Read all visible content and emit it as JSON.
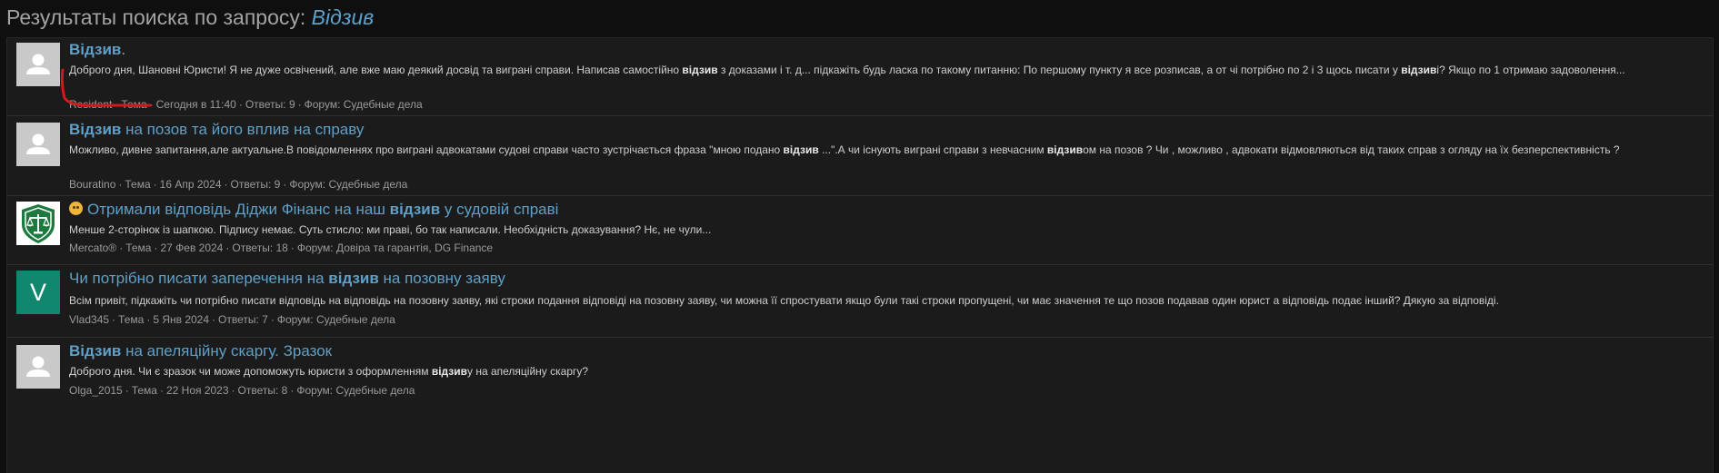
{
  "page": {
    "title_prefix": "Результаты поиска по запросу: ",
    "query": "Відзив"
  },
  "results": [
    {
      "title_parts": [
        "Відзив",
        "."
      ],
      "snippet": [
        "Доброго дня, Шановні Юристи! Я не дуже освічений, але вже маю деякий досвід та виграні справи. Написав самостійно ",
        "відзив",
        " з доказами і т. д... підкажіть будь ласка по такому питанню: По першому пункту я все розписав, а от чі потрібно по 2 і 3 щось писати у ",
        "відзив",
        "і? Якщо по 1 отримаю задоволення..."
      ],
      "meta": {
        "author": "Resident",
        "type": "Тема",
        "date": "Сегодня в 11:40",
        "replies": "Ответы: 9",
        "forum": "Форум: Судебные дела"
      },
      "avatar": "default-user"
    },
    {
      "title_parts": [
        "Відзив",
        " на позов та його вплив на справу"
      ],
      "snippet": [
        "Можливо, дивне запитання,але актуальне.В повідомленнях про виграні адвокатами судові справи часто зустрічається фраза \"мною подано ",
        "відзив",
        " ...\".А чи існують виграні справи з невчасним ",
        "відзив",
        "ом на позов ? Чи , можливо , адвокати відмовляються від таких справ з огляду на їх безперспективність ?"
      ],
      "meta": {
        "author": "Bouratino",
        "type": "Тема",
        "date": "16 Апр 2024",
        "replies": "Ответы: 9",
        "forum": "Форум: Судебные дела"
      },
      "avatar": "default-user"
    },
    {
      "title_parts": [
        "Отримали відповідь Діджи Фінанс на наш ",
        "відзив",
        " у судовій справі"
      ],
      "snippet": [
        "Менше 2-сторінок із шапкою. Підпису немає. Суть стисло: ми праві, бо так написали. Необхідність доказування? Нє, не чули..."
      ],
      "meta": {
        "author": "Mercato®",
        "type": "Тема",
        "date": "27 Фев 2024",
        "replies": "Ответы: 18",
        "forum": "Форум: Довіра та гарантія, DG Finance"
      },
      "avatar": "scales-logo"
    },
    {
      "title_parts": [
        "Чи потрібно писати заперечення на ",
        "відзив",
        " на позовну заяву"
      ],
      "snippet": [
        "Всім привіт, підкажіть чи потрібно писати відповідь на відповідь на позовну заяву, які строки подання відповіді на позовну заяву, чи можна її спростувати якщо були такі строки пропущені, чи має значення те що позов подавав один юрист а відповідь подає інший? Дякую за відповіді."
      ],
      "meta": {
        "author": "Vlad345",
        "type": "Тема",
        "date": "5 Янв 2024",
        "replies": "Ответы: 7",
        "forum": "Форум: Судебные дела"
      },
      "avatar_letter": "V"
    },
    {
      "title_parts": [
        "Відзив",
        " на апеляційну скаргу. Зразок"
      ],
      "snippet": [
        "Доброго дня. Чи є зразок чи може допоможуть юристи з оформленням ",
        "відзив",
        "у на апеляційну скаргу?"
      ],
      "meta": {
        "author": "Olga_2015",
        "type": "Тема",
        "date": "22 Ноя 2023",
        "replies": "Ответы: 8",
        "forum": "Форум: Судебные дела"
      },
      "avatar": "default-user"
    }
  ],
  "colors": {
    "background": "#0f0f0f",
    "panel": "#1b1b1b",
    "link": "#5ea0c8",
    "annotation": "#d11a1a",
    "avatar_letter_bg": "#12876f"
  }
}
